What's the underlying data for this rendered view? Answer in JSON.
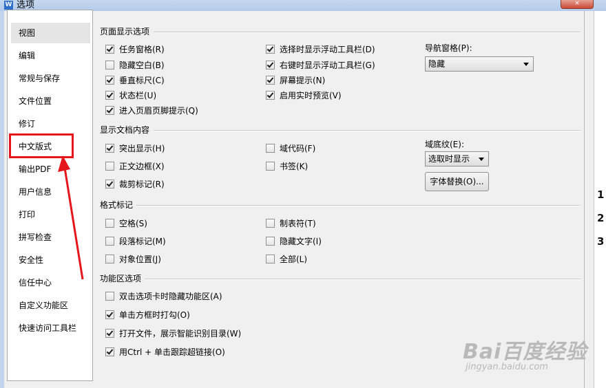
{
  "window": {
    "title": "选项",
    "app_icon": "wps-icon",
    "close_label": "×"
  },
  "sidebar": {
    "items": [
      {
        "label": "视图"
      },
      {
        "label": "编辑"
      },
      {
        "label": "常规与保存"
      },
      {
        "label": "文件位置"
      },
      {
        "label": "修订"
      },
      {
        "label": "中文版式"
      },
      {
        "label": "输出PDF"
      },
      {
        "label": "用户信息"
      },
      {
        "label": "打印"
      },
      {
        "label": "拼写检查"
      },
      {
        "label": "安全性"
      },
      {
        "label": "信任中心"
      },
      {
        "label": "自定义功能区"
      },
      {
        "label": "快速访问工具栏"
      }
    ],
    "selected": "视图",
    "annotated": "中文版式"
  },
  "page_display": {
    "title": "页面显示选项",
    "col1": [
      {
        "label": "任务窗格(R)",
        "checked": true
      },
      {
        "label": "隐藏空白(B)",
        "checked": false
      },
      {
        "label": "垂直标尺(C)",
        "checked": true
      },
      {
        "label": "状态栏(U)",
        "checked": true
      },
      {
        "label": "进入页眉页脚提示(Q)",
        "checked": true
      }
    ],
    "col2": [
      {
        "label": "选择时显示浮动工具栏(D)",
        "checked": true
      },
      {
        "label": "右键时显示浮动工具栏(G)",
        "checked": true
      },
      {
        "label": "屏幕提示(N)",
        "checked": true
      },
      {
        "label": "启用实时预览(V)",
        "checked": true
      }
    ],
    "nav_pane_label": "导航窗格(P):",
    "nav_pane_value": "隐藏"
  },
  "doc_content": {
    "title": "显示文档内容",
    "col1": [
      {
        "label": "突出显示(H)",
        "checked": true
      },
      {
        "label": "正文边框(X)",
        "checked": false
      },
      {
        "label": "裁剪标记(R)",
        "checked": true
      }
    ],
    "col2": [
      {
        "label": "域代码(F)",
        "checked": false
      },
      {
        "label": "书签(K)",
        "checked": false
      }
    ],
    "field_shading_label": "域底纹(E):",
    "field_shading_value": "选取时显示",
    "font_replace_button": "字体替换(O)..."
  },
  "format_marks": {
    "title": "格式标记",
    "col1": [
      {
        "label": "空格(S)",
        "checked": false
      },
      {
        "label": "段落标记(M)",
        "checked": false
      },
      {
        "label": "对象位置(J)",
        "checked": false
      }
    ],
    "col2": [
      {
        "label": "制表符(T)",
        "checked": false
      },
      {
        "label": "隐藏文字(I)",
        "checked": false
      },
      {
        "label": "全部(L)",
        "checked": false
      }
    ]
  },
  "ribbon_options": {
    "title": "功能区选项",
    "items": [
      {
        "label": "双击选项卡时隐藏功能区(A)",
        "checked": false
      },
      {
        "label": "单击方框时打勾(O)",
        "checked": true
      },
      {
        "label": "打开文件，展示智能识别目录(W)",
        "checked": true
      },
      {
        "label": "用Ctrl + 单击跟踪超链接(O)",
        "checked": true
      }
    ]
  },
  "background_doc": {
    "snippets": [
      "1",
      "2",
      "3"
    ]
  },
  "watermark": {
    "main": "Bai百度经验",
    "sub": "jingyan.baidu.com"
  },
  "colors": {
    "annotation_red": "#e4161b",
    "window_accent": "#c3d5ee"
  }
}
